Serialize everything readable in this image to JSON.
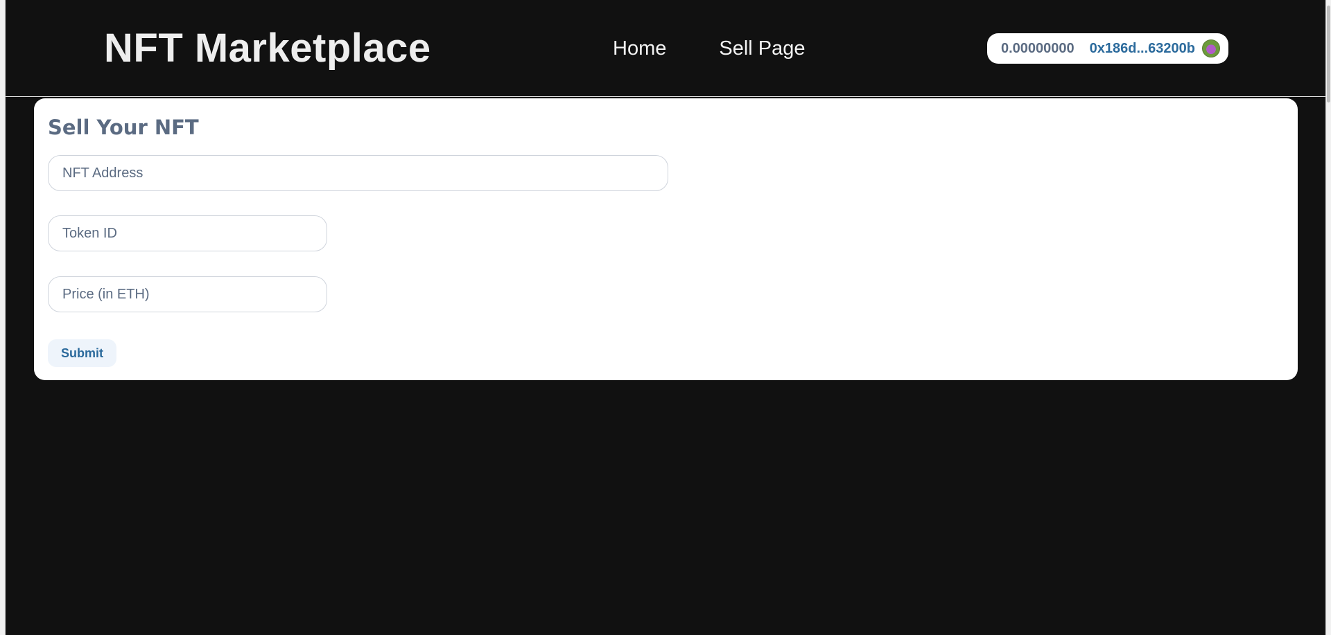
{
  "header": {
    "title": "NFT Marketplace",
    "nav": [
      {
        "label": "Home"
      },
      {
        "label": "Sell Page"
      }
    ],
    "wallet": {
      "balance": "0.00000000",
      "address": "0x186d...63200b"
    }
  },
  "sell_form": {
    "title": "Sell Your NFT",
    "nft_address": {
      "placeholder": "NFT Address",
      "value": ""
    },
    "token_id": {
      "placeholder": "Token ID",
      "value": ""
    },
    "price": {
      "placeholder": "Price (in ETH)",
      "value": ""
    },
    "submit_label": "Submit"
  },
  "colors": {
    "background": "#111111",
    "card": "#ffffff",
    "muted_text": "#5b6b82",
    "accent": "#2b6a9c"
  }
}
